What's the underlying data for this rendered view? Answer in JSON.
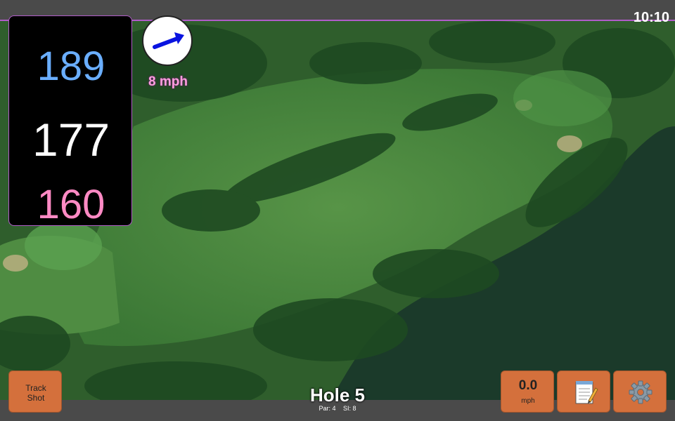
{
  "status": {
    "time": "10:10"
  },
  "distances": {
    "back": "189",
    "middle": "177",
    "front": "160"
  },
  "wind": {
    "speed": "8 mph",
    "icon": "wind-direction-arrow-icon"
  },
  "buttons": {
    "track_shot_line1": "Track",
    "track_shot_line2": "Shot",
    "speed_value": "0.0",
    "speed_unit": "mph",
    "notes_icon": "notepad-icon",
    "settings_icon": "gear-icon"
  },
  "hole": {
    "title": "Hole 5",
    "par": "Par: 4",
    "si": "SI: 8"
  },
  "colors": {
    "accent": "#b05cc8",
    "button": "#d4703c",
    "back_distance": "#6aaeff",
    "front_distance": "#ff8ac4",
    "wind_arrow": "#0a14e0"
  }
}
